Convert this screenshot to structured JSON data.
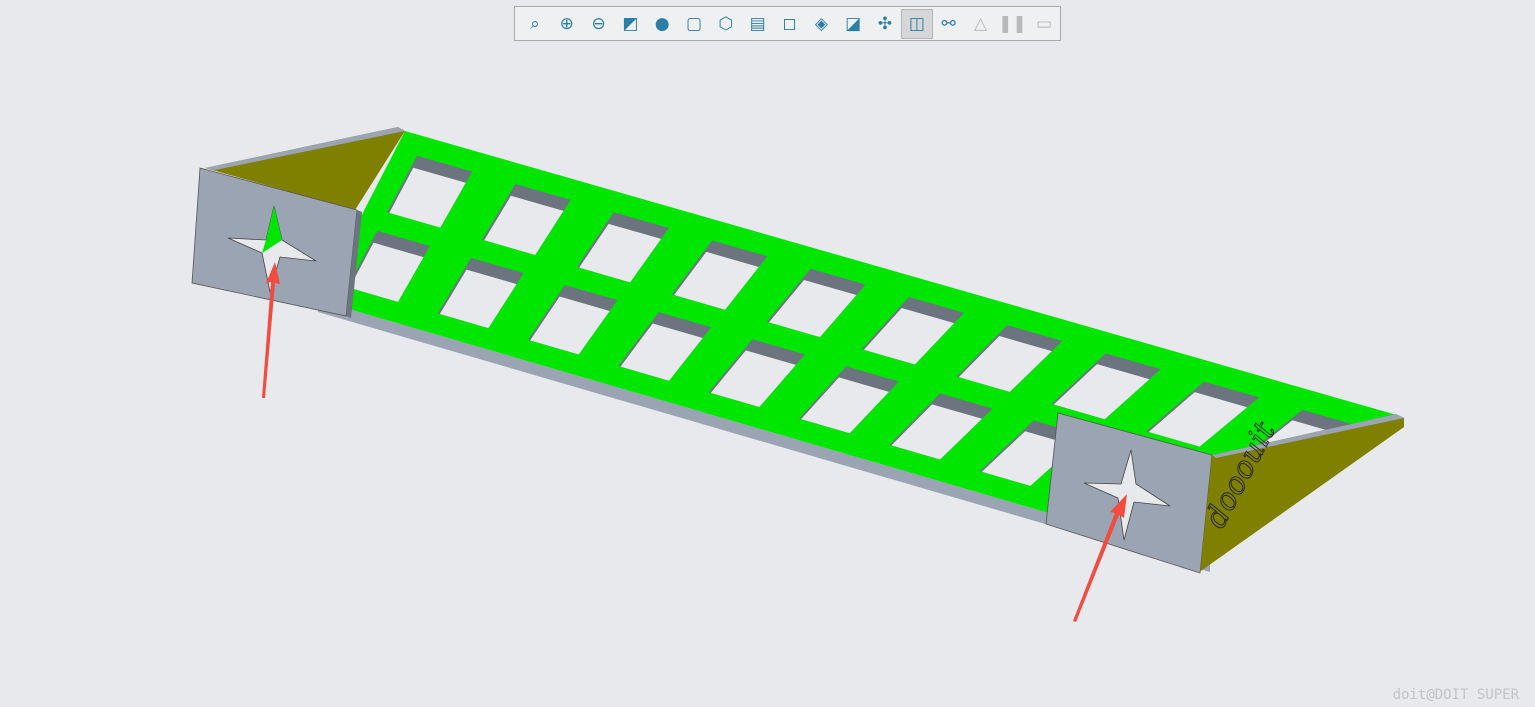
{
  "toolbar": {
    "buttons": [
      {
        "icon": "zoom-fit-icon",
        "glyph": "⌕"
      },
      {
        "icon": "zoom-in-icon",
        "glyph": "⊕"
      },
      {
        "icon": "zoom-out-icon",
        "glyph": "⊖"
      },
      {
        "icon": "refit-icon",
        "glyph": "◩"
      },
      {
        "icon": "display-style-icon",
        "glyph": "●"
      },
      {
        "icon": "standard-orientation-icon",
        "glyph": "▢"
      },
      {
        "icon": "saved-views-icon",
        "glyph": "⬡"
      },
      {
        "icon": "view-manager-icon",
        "glyph": "▤"
      },
      {
        "icon": "named-view-icon",
        "glyph": "◻"
      },
      {
        "icon": "perspective-icon",
        "glyph": "◈"
      },
      {
        "icon": "section-icon",
        "glyph": "◪"
      },
      {
        "icon": "datum-display-icon",
        "glyph": "✣"
      },
      {
        "icon": "annotation-display-icon",
        "glyph": "◫",
        "active": true
      },
      {
        "icon": "spin-center-icon",
        "glyph": "⚯"
      },
      {
        "icon": "simulation-icon",
        "glyph": "△",
        "disabled": true
      },
      {
        "icon": "pause-icon",
        "glyph": "❚❚",
        "disabled": true
      },
      {
        "icon": "next-icon",
        "glyph": "▭",
        "disabled": true
      }
    ]
  },
  "model": {
    "engraved_text": "dooouit",
    "colors": {
      "top_face": "#00e600",
      "side_face": "#9aa4b2",
      "end_plate": "#98a3b1",
      "triangle_face": "#7f7f00",
      "annotation_arrow": "#f24b3f",
      "background": "#e8e9ed"
    }
  },
  "watermark": "doit@DOIT SUPER"
}
